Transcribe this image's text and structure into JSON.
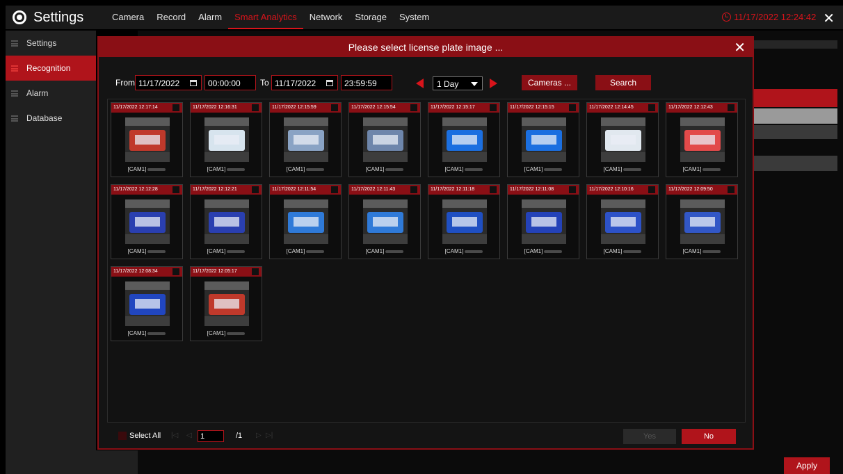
{
  "app": {
    "title": "Settings",
    "clock": "11/17/2022 12:24:42"
  },
  "nav": [
    "Camera",
    "Record",
    "Alarm",
    "Smart Analytics",
    "Network",
    "Storage",
    "System"
  ],
  "sidebar": [
    {
      "label": "Settings",
      "active": false
    },
    {
      "label": "Recognition",
      "active": true
    },
    {
      "label": "Alarm",
      "active": false
    },
    {
      "label": "Database",
      "active": false
    }
  ],
  "apply_label": "Apply",
  "modal": {
    "title": "Please select license plate image ...",
    "from_label": "From",
    "from_date": "11/17/2022",
    "from_time": "00:00:00",
    "to_label": "To",
    "to_date": "11/17/2022",
    "to_time": "23:59:59",
    "range": "1 Day",
    "cameras_label": "Cameras ...",
    "search_label": "Search",
    "select_all_label": "Select All",
    "page_current": "1",
    "page_total": "/1",
    "yes_label": "Yes",
    "no_label": "No"
  },
  "results": [
    {
      "time": "11/17/2022 12:17:14",
      "cam": "[CAM1]",
      "plate_color": "#c0392b"
    },
    {
      "time": "11/17/2022 12:16:31",
      "cam": "[CAM1]",
      "plate_color": "#d7e4ee"
    },
    {
      "time": "11/17/2022 12:15:59",
      "cam": "[CAM1]",
      "plate_color": "#8aa3c4"
    },
    {
      "time": "11/17/2022 12:15:54",
      "cam": "[CAM1]",
      "plate_color": "#6e86ab"
    },
    {
      "time": "11/17/2022 12:15:17",
      "cam": "[CAM1]",
      "plate_color": "#1b6fe0"
    },
    {
      "time": "11/17/2022 12:15:15",
      "cam": "[CAM1]",
      "plate_color": "#1b6fe0"
    },
    {
      "time": "11/17/2022 12:14:45",
      "cam": "[CAM1]",
      "plate_color": "#e1e8ef"
    },
    {
      "time": "11/17/2022 12:12:43",
      "cam": "[CAM1]",
      "plate_color": "#e24a4a"
    },
    {
      "time": "11/17/2022 12:12:28",
      "cam": "[CAM1]",
      "plate_color": "#2a3fb0"
    },
    {
      "time": "11/17/2022 12:12:21",
      "cam": "[CAM1]",
      "plate_color": "#2a3fb0"
    },
    {
      "time": "11/17/2022 12:11:54",
      "cam": "[CAM1]",
      "plate_color": "#2f7ad8"
    },
    {
      "time": "11/17/2022 12:11:43",
      "cam": "[CAM1]",
      "plate_color": "#2f7ad8"
    },
    {
      "time": "11/17/2022 12:11:18",
      "cam": "[CAM1]",
      "plate_color": "#1f4fc2"
    },
    {
      "time": "11/17/2022 12:11:08",
      "cam": "[CAM1]",
      "plate_color": "#2442b8"
    },
    {
      "time": "11/17/2022 12:10:16",
      "cam": "[CAM1]",
      "plate_color": "#2d52c8"
    },
    {
      "time": "11/17/2022 12:09:50",
      "cam": "[CAM1]",
      "plate_color": "#3257c6"
    },
    {
      "time": "11/17/2022 12:08:34",
      "cam": "[CAM1]",
      "plate_color": "#2146c0"
    },
    {
      "time": "11/17/2022 12:05:17",
      "cam": "[CAM1]",
      "plate_color": "#c0392b"
    }
  ]
}
